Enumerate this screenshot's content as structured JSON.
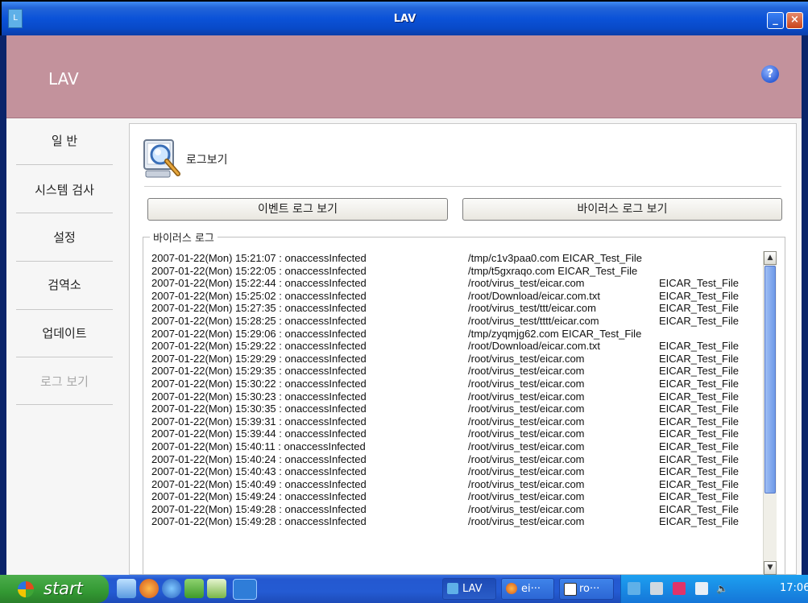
{
  "window": {
    "title": "LAV",
    "min_label": "_",
    "close_label": "×",
    "app_icon_label": "L"
  },
  "banner": {
    "title": "LAV",
    "help_label": "?"
  },
  "sidebar": {
    "items": [
      {
        "label": "일 반"
      },
      {
        "label": "시스템 검사"
      },
      {
        "label": "설정"
      },
      {
        "label": "검역소"
      },
      {
        "label": "업데이트"
      },
      {
        "label": "로그 보기",
        "disabled": true
      }
    ]
  },
  "content": {
    "title": "로그보기",
    "event_log_button": "이벤트 로그 보기",
    "virus_log_button": "바이러스 로그 보기",
    "group_label": "바이러스 로그"
  },
  "log": {
    "rows": [
      [
        "2007-01-22(Mon) 15:21:07 : onaccessInfected",
        "/tmp/c1v3paa0.com EICAR_Test_File",
        ""
      ],
      [
        "2007-01-22(Mon) 15:22:05 : onaccessInfected",
        "/tmp/t5gxraqo.com EICAR_Test_File",
        ""
      ],
      [
        "2007-01-22(Mon) 15:22:44 : onaccessInfected",
        "/root/virus_test/eicar.com",
        "EICAR_Test_File"
      ],
      [
        "2007-01-22(Mon) 15:25:02 : onaccessInfected",
        "/root/Download/eicar.com.txt",
        "EICAR_Test_File"
      ],
      [
        "2007-01-22(Mon) 15:27:35 : onaccessInfected",
        "/root/virus_test/ttt/eicar.com",
        "EICAR_Test_File"
      ],
      [
        "2007-01-22(Mon) 15:28:25 : onaccessInfected",
        "/root/virus_test/tttt/eicar.com",
        "EICAR_Test_File"
      ],
      [
        "2007-01-22(Mon) 15:29:06 : onaccessInfected",
        "/tmp/zyqmjg62.com EICAR_Test_File",
        ""
      ],
      [
        "2007-01-22(Mon) 15:29:22 : onaccessInfected",
        "/root/Download/eicar.com.txt",
        "EICAR_Test_File"
      ],
      [
        "2007-01-22(Mon) 15:29:29 : onaccessInfected",
        "/root/virus_test/eicar.com",
        "EICAR_Test_File"
      ],
      [
        "2007-01-22(Mon) 15:29:35 : onaccessInfected",
        "/root/virus_test/eicar.com",
        "EICAR_Test_File"
      ],
      [
        "2007-01-22(Mon) 15:30:22 : onaccessInfected",
        "/root/virus_test/eicar.com",
        "EICAR_Test_File"
      ],
      [
        "2007-01-22(Mon) 15:30:23 : onaccessInfected",
        "/root/virus_test/eicar.com",
        "EICAR_Test_File"
      ],
      [
        "2007-01-22(Mon) 15:30:35 : onaccessInfected",
        "/root/virus_test/eicar.com",
        "EICAR_Test_File"
      ],
      [
        "2007-01-22(Mon) 15:39:31 : onaccessInfected",
        "/root/virus_test/eicar.com",
        "EICAR_Test_File"
      ],
      [
        "2007-01-22(Mon) 15:39:44 : onaccessInfected",
        "/root/virus_test/eicar.com",
        "EICAR_Test_File"
      ],
      [
        "2007-01-22(Mon) 15:40:11 : onaccessInfected",
        "/root/virus_test/eicar.com",
        "EICAR_Test_File"
      ],
      [
        "2007-01-22(Mon) 15:40:24 : onaccessInfected",
        "/root/virus_test/eicar.com",
        "EICAR_Test_File"
      ],
      [
        "2007-01-22(Mon) 15:40:43 : onaccessInfected",
        "/root/virus_test/eicar.com",
        "EICAR_Test_File"
      ],
      [
        "2007-01-22(Mon) 15:40:49 : onaccessInfected",
        "/root/virus_test/eicar.com",
        "EICAR_Test_File"
      ],
      [
        "2007-01-22(Mon) 15:49:24 : onaccessInfected",
        "/root/virus_test/eicar.com",
        "EICAR_Test_File"
      ],
      [
        "2007-01-22(Mon) 15:49:28 : onaccessInfected",
        "/root/virus_test/eicar.com",
        "EICAR_Test_File"
      ],
      [
        "2007-01-22(Mon) 15:49:28 : onaccessInfected",
        "/root/virus_test/eicar.com",
        "EICAR_Test_File"
      ]
    ]
  },
  "scrollbar": {
    "up_label": "▲",
    "down_label": "▼"
  },
  "taskbar": {
    "start_label": "start",
    "tasks": [
      {
        "label": "LAV",
        "icon": "lav-icon"
      },
      {
        "label": "ei···",
        "icon": "firefox-icon"
      },
      {
        "label": "ro···",
        "icon": "terminal-icon"
      }
    ],
    "clock": "17:06",
    "colors": {
      "start": "#339933",
      "taskbar": "#245bd3",
      "tray": "#1576d8"
    }
  },
  "colors": {
    "banner": "#c3929c",
    "titlebar": "#0b52d8"
  }
}
